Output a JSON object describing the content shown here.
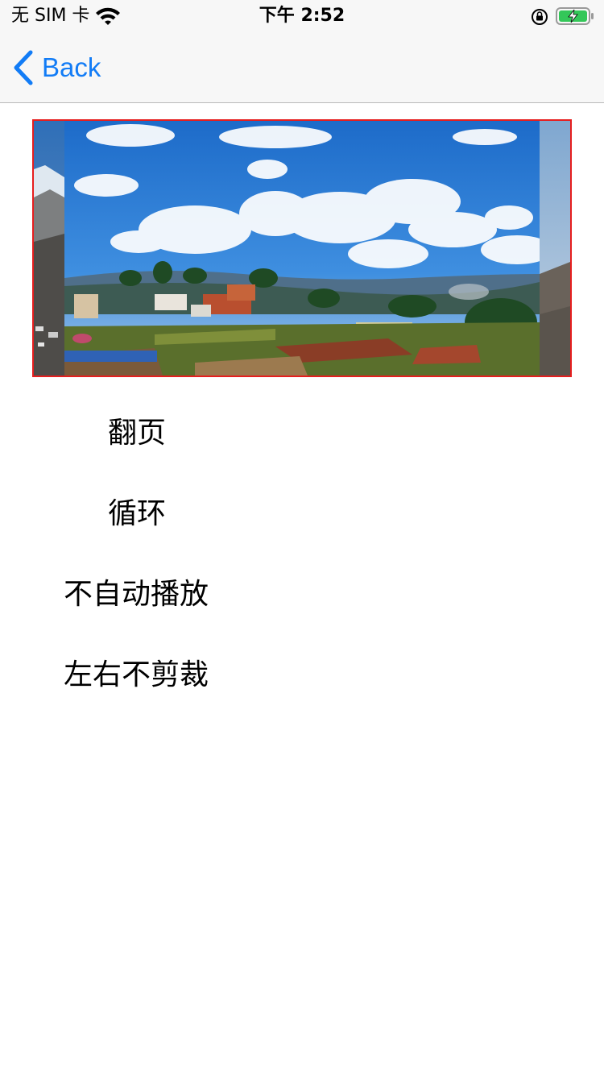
{
  "status_bar": {
    "carrier": "无 SIM 卡",
    "time": "下午 2:52",
    "wifi_icon": "wifi-icon",
    "lock_icon": "orientation-lock-icon",
    "battery_icon": "battery-charging-icon",
    "battery_color": "#34c759"
  },
  "navbar": {
    "back_label": "Back",
    "accent_color": "#127cf6"
  },
  "banner": {
    "border_color": "#e61e1e",
    "current_image": "landscape-village-photo",
    "prev_image": "snow-mountain-photo",
    "next_image": "mountain-photo"
  },
  "options": [
    {
      "label": "翻页"
    },
    {
      "label": "循环"
    },
    {
      "label": "不自动播放"
    },
    {
      "label": "左右不剪裁"
    }
  ]
}
